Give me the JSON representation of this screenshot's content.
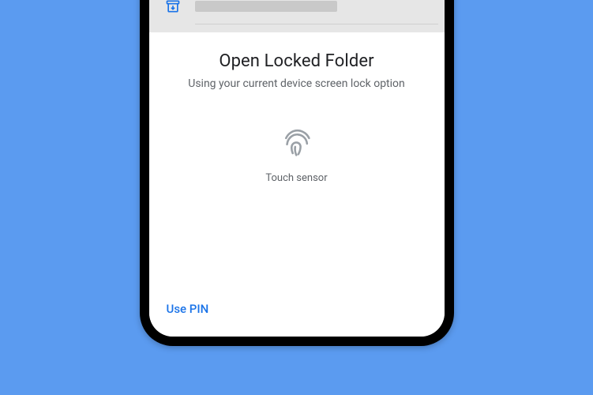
{
  "sheet": {
    "title": "Open Locked Folder",
    "subtitle": "Using your current device screen lock option",
    "sensor_label": "Touch sensor",
    "use_pin_label": "Use PIN"
  },
  "colors": {
    "background": "#5b9bf0",
    "accent": "#1a73e8"
  },
  "icons": {
    "archive": "archive-box-icon",
    "fingerprint": "fingerprint-icon"
  }
}
